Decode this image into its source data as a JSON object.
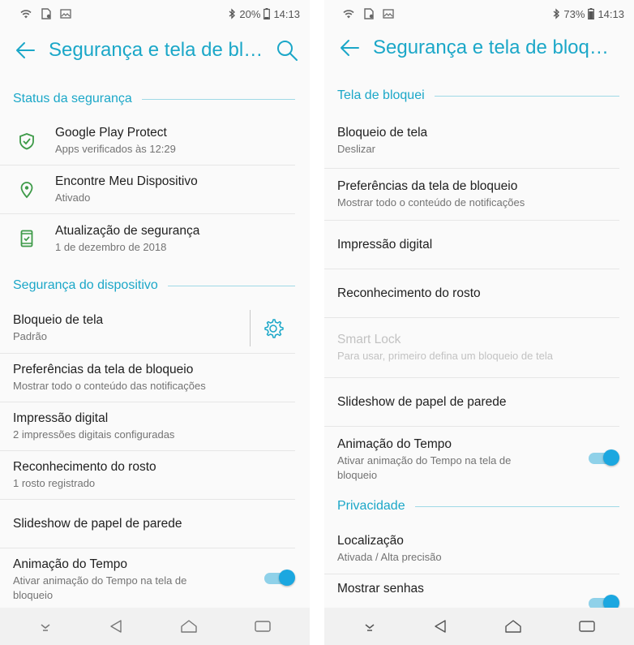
{
  "left": {
    "status": {
      "battery": "20%",
      "time": "14:13"
    },
    "title": "Segurança e tela de bloq…",
    "sections": {
      "security_status": "Status da segurança",
      "device_security": "Segurança do dispositivo"
    },
    "status_items": [
      {
        "title": "Google Play Protect",
        "subtitle": "Apps verificados às 12:29",
        "icon": "shield-check-icon"
      },
      {
        "title": "Encontre Meu Dispositivo",
        "subtitle": "Ativado",
        "icon": "location-pin-icon"
      },
      {
        "title": "Atualização de segurança",
        "subtitle": "1 de dezembro de 2018",
        "icon": "phone-update-icon"
      }
    ],
    "device_items": [
      {
        "title": "Bloqueio de tela",
        "subtitle": "Padrão"
      },
      {
        "title": "Preferências da tela de bloqueio",
        "subtitle": "Mostrar todo o conteúdo das notificações"
      },
      {
        "title": "Impressão digital",
        "subtitle": "2 impressões digitais configuradas"
      },
      {
        "title": "Reconhecimento do rosto",
        "subtitle": "1 rosto registrado"
      },
      {
        "title": "Slideshow de papel de parede"
      },
      {
        "title": "Animação do Tempo",
        "subtitle": "Ativar animação do Tempo na tela de bloqueio",
        "toggle": 1
      }
    ]
  },
  "right": {
    "status": {
      "battery": "73%",
      "time": "14:13"
    },
    "title": "Segurança e tela de bloqu…",
    "sections": {
      "lock_screen": "Tela de bloquei",
      "privacy": "Privacidade"
    },
    "lock_items": [
      {
        "title": "Bloqueio de tela",
        "subtitle": "Deslizar"
      },
      {
        "title": "Preferências da tela de bloqueio",
        "subtitle": "Mostrar todo o conteúdo de notificações"
      },
      {
        "title": "Impressão digital"
      },
      {
        "title": "Reconhecimento do rosto"
      },
      {
        "title": "Smart Lock",
        "subtitle": "Para usar, primeiro defina um bloqueio de tela",
        "disabled": true
      },
      {
        "title": "Slideshow de papel de parede"
      },
      {
        "title": "Animação do Tempo",
        "subtitle": "Ativar animação do Tempo na tela de bloqueio",
        "toggle": 1
      }
    ],
    "privacy_items": [
      {
        "title": "Localização",
        "subtitle": "Ativada / Alta precisão"
      },
      {
        "title": "Mostrar senhas",
        "toggle": 1
      }
    ]
  },
  "colors": {
    "accent": "#1ba7c8",
    "icon_green": "#3d9a48",
    "toggle": "#1ba7e0"
  }
}
